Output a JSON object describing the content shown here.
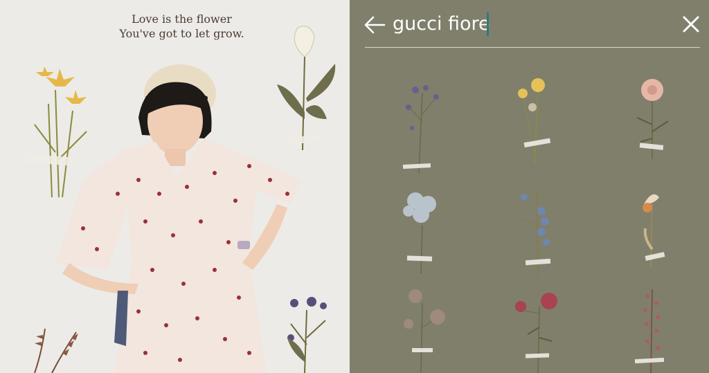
{
  "photo": {
    "quote_line1": "Love is the flower",
    "quote_line2": "You've got to let grow."
  },
  "search": {
    "query": "gucci fiore",
    "back_icon": "arrow-left-icon",
    "clear_icon": "close-icon"
  },
  "stickers": [
    {
      "name": "purple-wildflower-sticker"
    },
    {
      "name": "yellow-daffodil-sticker"
    },
    {
      "name": "pink-rose-sticker"
    },
    {
      "name": "blue-hydrangea-sticker"
    },
    {
      "name": "blue-delphinium-sticker"
    },
    {
      "name": "orange-iris-sticker"
    },
    {
      "name": "dusty-rose-sticker"
    },
    {
      "name": "red-rose-sticker"
    },
    {
      "name": "pink-spray-sticker"
    }
  ],
  "colors": {
    "panel_bg": "#7f7f6b",
    "caret": "#2a7d78",
    "photo_bg": "#ecebe8"
  }
}
